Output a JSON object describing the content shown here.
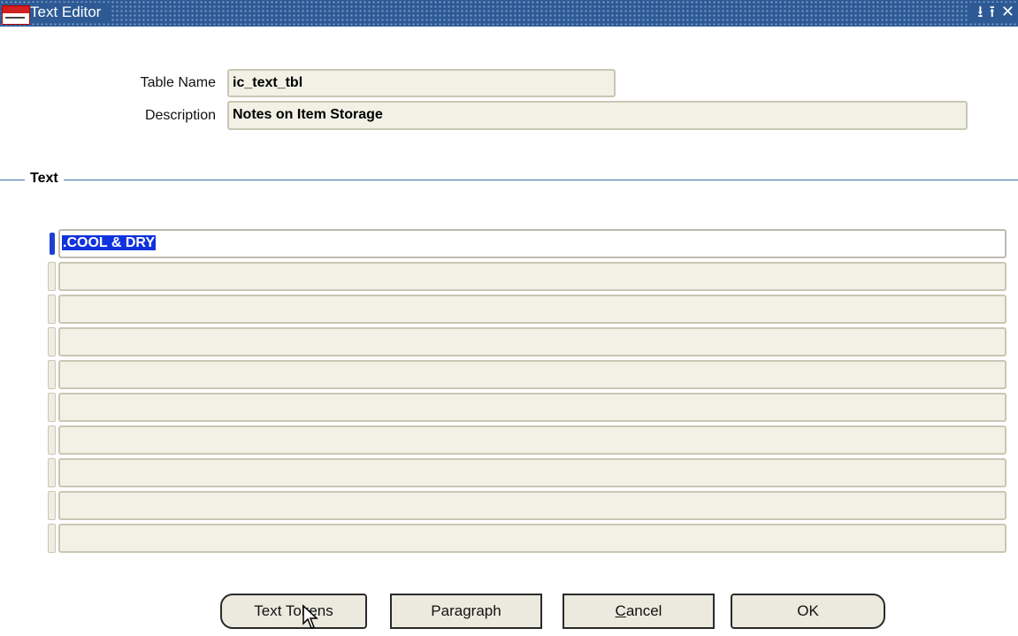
{
  "window": {
    "title": "Text Editor",
    "controls": [
      "minimize-icon",
      "restore-icon",
      "close-icon"
    ]
  },
  "form": {
    "table_name_label": "Table Name",
    "table_name_value": "ic_text_tbl",
    "description_label": "Description",
    "description_value": "Notes on Item Storage"
  },
  "section": {
    "title": "Text"
  },
  "text_lines": [
    ".COOL & DRY",
    "",
    "",
    "",
    "",
    "",
    "",
    "",
    "",
    ""
  ],
  "buttons": {
    "text_tokens": "Text Tokens",
    "paragraph": "Paragraph",
    "cancel_prefix": "",
    "cancel_mnemonic": "C",
    "cancel_rest": "ancel",
    "ok": "OK"
  },
  "colors": {
    "titlebar": "#2d5a95",
    "field_bg": "#f2f1e6",
    "selection": "#1133dd",
    "section_line": "#3a6ea5"
  }
}
